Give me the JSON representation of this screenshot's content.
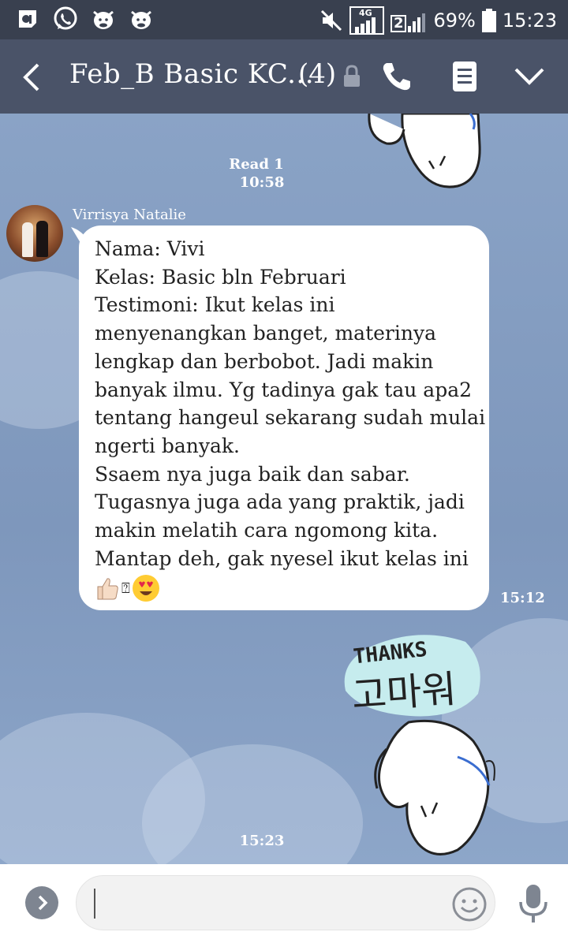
{
  "status_bar": {
    "battery_percent": "69%",
    "time": "15:23",
    "network_label": "4G",
    "sim2_label": "2",
    "left_icons": [
      "app-notification-icon",
      "whatsapp-icon",
      "cow-sticker-icon",
      "cow-sticker-icon"
    ],
    "right_icons": [
      "mute-icon",
      "signal-sim1-icon",
      "signal-sim2-icon",
      "battery-icon"
    ]
  },
  "header": {
    "title": "Feb_B Basic KC...",
    "member_count": "(4)",
    "icons": [
      "back-icon",
      "lock-icon",
      "phone-icon",
      "notes-icon",
      "chevron-down-icon"
    ]
  },
  "chat": {
    "read_receipt": "Read 1",
    "read_time": "10:58",
    "message": {
      "sender": "Virrisya Natalie",
      "lines": [
        "Nama: Vivi",
        "Kelas: Basic bln Februari",
        "Testimoni: Ikut kelas ini",
        "menyenangkan banget, materinya",
        "lengkap dan berbobot. Jadi makin",
        "banyak ilmu. Yg tadinya gak tau apa2",
        "tentang hangeul sekarang sudah mulai",
        "ngerti banyak.",
        "Ssaem nya juga baik dan sabar.",
        "Tugasnya juga ada yang praktik, jadi",
        "makin melatih cara ngomong kita.",
        "Mantap deh, gak nyesel ikut kelas ini"
      ],
      "emojis": [
        "👍🏻",
        "⍰",
        "😍"
      ],
      "time": "15:12"
    },
    "sticker": {
      "text_en": "THANKS",
      "text_ko": "고마워",
      "time": "15:23"
    }
  },
  "input_bar": {
    "placeholder": "",
    "icons": [
      "expand-arrow-icon",
      "emoji-icon",
      "microphone-icon"
    ]
  },
  "colors": {
    "status_bar": "#39404f",
    "header": "#4a5368",
    "chat_background": "#7f98bd",
    "bubble": "#ffffff",
    "sticker_bubble": "#c6ecee"
  }
}
